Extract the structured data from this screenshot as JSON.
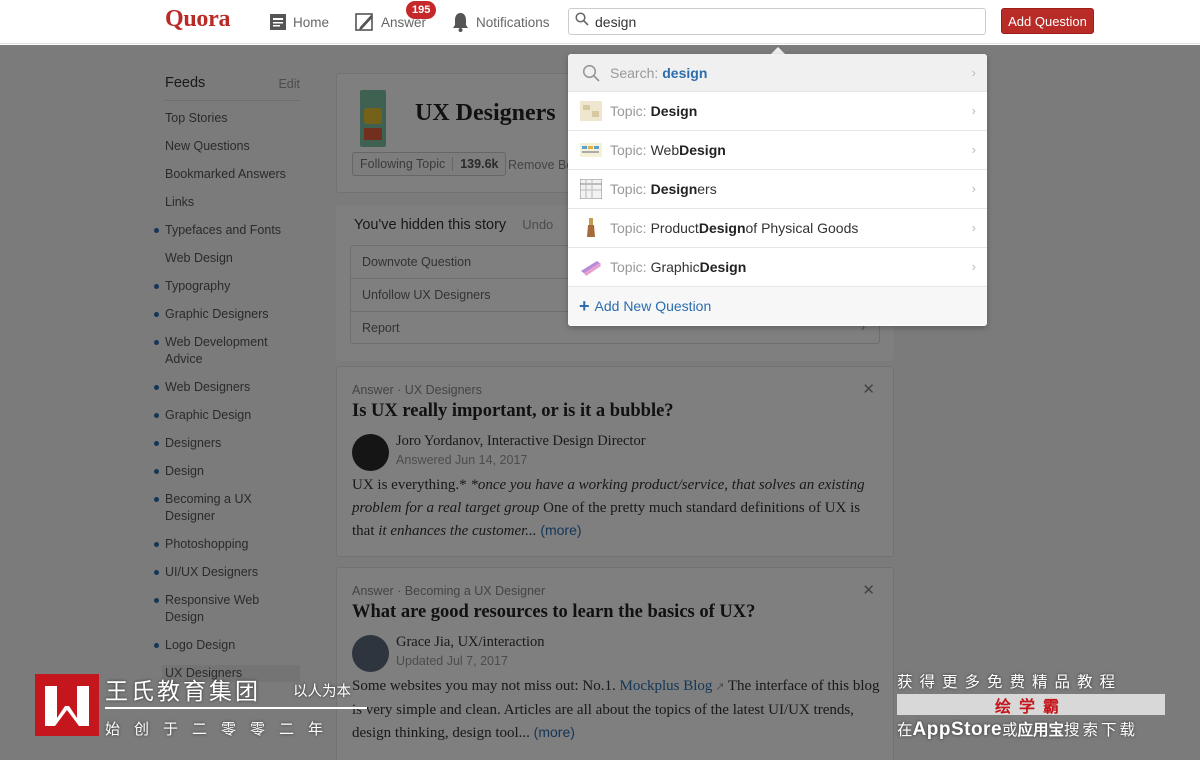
{
  "header": {
    "logo": "Quora",
    "nav": {
      "home": "Home",
      "answer": "Answer",
      "answer_badge": "195",
      "notifications": "Notifications"
    },
    "search_value": "design",
    "add_question": "Add Question"
  },
  "sidebar": {
    "title": "Feeds",
    "edit": "Edit",
    "items": [
      {
        "label": "Top Stories",
        "dot": false
      },
      {
        "label": "New Questions",
        "dot": false
      },
      {
        "label": "Bookmarked Answers",
        "dot": false
      },
      {
        "label": "Links",
        "dot": false
      },
      {
        "label": "Typefaces and Fonts",
        "dot": true
      },
      {
        "label": "Web Design",
        "dot": false
      },
      {
        "label": "Typography",
        "dot": true
      },
      {
        "label": "Graphic Designers",
        "dot": true
      },
      {
        "label": "Web Development Advice",
        "dot": true
      },
      {
        "label": "Web Designers",
        "dot": true
      },
      {
        "label": "Graphic Design",
        "dot": true
      },
      {
        "label": "Designers",
        "dot": true
      },
      {
        "label": "Design",
        "dot": true
      },
      {
        "label": "Becoming a UX Designer",
        "dot": true
      },
      {
        "label": "Photoshopping",
        "dot": true
      },
      {
        "label": "UI/UX Designers",
        "dot": true
      },
      {
        "label": "Responsive Web Design",
        "dot": true
      },
      {
        "label": "Logo Design",
        "dot": true
      },
      {
        "label": "UX Designers",
        "dot": false
      }
    ]
  },
  "topic": {
    "title": "UX Designers",
    "following_label": "Following Topic",
    "following_count": "139.6k",
    "remove_label": "Remove Bo"
  },
  "hidden_story": {
    "message": "You've hidden this story",
    "undo": "Undo",
    "options": [
      "Downvote Question",
      "Unfollow UX Designers",
      "Report"
    ]
  },
  "answers": [
    {
      "meta": "Answer · UX Designers",
      "question": "Is UX really important, or is it a bubble?",
      "author": "Joro Yordanov, Interactive Design Director",
      "answered": "Answered Jun 14, 2017",
      "body_1": "UX is everything.* ",
      "body_italic": "*once you have a working product/service, that solves an existing problem for a real target group",
      "body_2": " One of the pretty much standard definitions of UX is that ",
      "body_italic2": "it enhances the customer...",
      "more": "(more)"
    },
    {
      "meta": "Answer · Becoming a UX Designer",
      "question": "What are good resources to learn the basics of UX?",
      "author": "Grace Jia, UX/interaction",
      "answered": "Updated Jul 7, 2017",
      "body_1": "Some websites you may not miss out: No.1. ",
      "link": "Mockplus Blog",
      "body_2": " The interface of this blog is very simple and clean. Articles are all about the topics of the latest UI/UX trends, design thinking, design tool...",
      "more": "(more)"
    }
  ],
  "dropdown": {
    "search_label": "Search:",
    "search_term": "design",
    "topic_label": "Topic:",
    "results": [
      {
        "pre": "",
        "bold": "Design",
        "post": ""
      },
      {
        "pre": "Web ",
        "bold": "Design",
        "post": ""
      },
      {
        "pre": "",
        "bold": "Design",
        "post": "ers"
      },
      {
        "pre": "Product ",
        "bold": "Design",
        "post": " of Physical Goods"
      },
      {
        "pre": "Graphic ",
        "bold": "Design",
        "post": ""
      }
    ],
    "add_new": "Add New Question"
  },
  "watermark": {
    "left_name": "王氏教育集团",
    "left_slogan": "以人为本",
    "left_sub": "始创于二零零二年",
    "right_line1": "获得更多免费精品教程",
    "right_brand": "绘学霸",
    "right_line3_a": "在",
    "right_line3_b": "AppStore",
    "right_line3_c": "或",
    "right_line3_d": "应用宝",
    "right_line3_e": "搜索下载"
  }
}
